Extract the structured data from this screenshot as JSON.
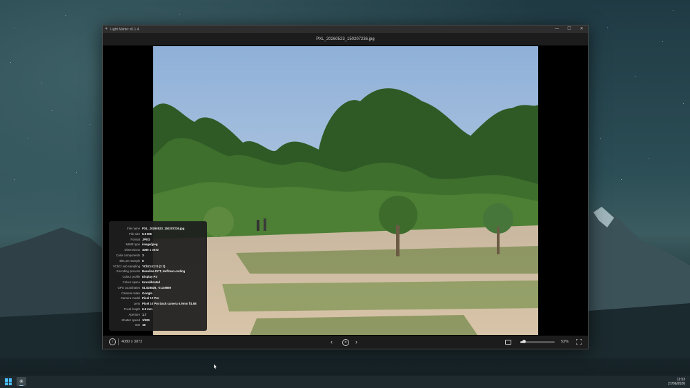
{
  "window": {
    "title": "Light Matter v0.1.4",
    "controls": {
      "minimize": "—",
      "maximize": "☐",
      "close": "✕"
    },
    "filename": "PXL_20260523_150207236.jpg"
  },
  "info_panel": {
    "rows": [
      {
        "label": "File name",
        "value": "PXL_20260523_150207236.jpg"
      },
      {
        "label": "File size",
        "value": "5.5 MB"
      },
      {
        "label": "Format",
        "value": "JPEG"
      },
      {
        "label": "MIME type",
        "value": "image/jpeg"
      },
      {
        "label": "Dimensions",
        "value": "4080 x 3072"
      },
      {
        "label": "Color components",
        "value": "3"
      },
      {
        "label": "Bits per sample",
        "value": "8"
      },
      {
        "label": "YCbCr sub sampling",
        "value": "YCbCr4:2:0 (2 2)"
      },
      {
        "label": "Encoding process",
        "value": "Baseline DCT, Huffman coding"
      },
      {
        "label": "Colour profile",
        "value": "Display P3"
      },
      {
        "label": "Colour space",
        "value": "Uncalibrated"
      },
      {
        "label": "GPS coordinates",
        "value": "51.528828, -0.149869"
      },
      {
        "label": "Camera make",
        "value": "Google"
      },
      {
        "label": "Camera model",
        "value": "Pixel 10 Pro"
      },
      {
        "label": "Lens",
        "value": "Pixel 10 Pro back camera 6.9mm f/1.68"
      },
      {
        "label": "Focal length",
        "value": "6.9 mm"
      },
      {
        "label": "Aperture",
        "value": "1.7"
      },
      {
        "label": "Shutter speed",
        "value": "1/929"
      },
      {
        "label": "ISO",
        "value": "18"
      }
    ]
  },
  "bottom_bar": {
    "info_icon": "info-icon",
    "dimensions": "4080 x 3072",
    "prev_icon": "‹",
    "close_icon": "✕",
    "next_icon": "›",
    "zoom_percent": "53%",
    "zoom_level": 0.53
  },
  "taskbar": {
    "time": "11:53",
    "date": "27/06/2026"
  },
  "colors": {
    "accent": "#4cc2ff",
    "window_bg": "#000000",
    "panel_bg": "#1e1e1e"
  }
}
